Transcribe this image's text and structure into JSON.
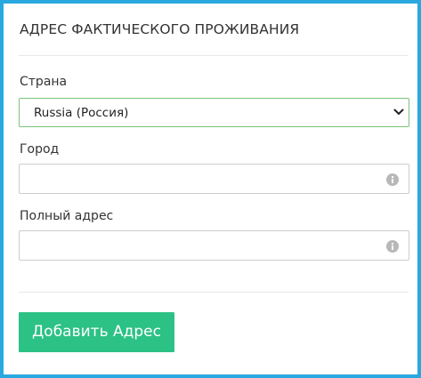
{
  "section": {
    "title": "АДРЕС ФАКТИЧЕСКОГО ПРОЖИВАНИЯ"
  },
  "country": {
    "label": "Страна",
    "selected": "Russia (Россия)"
  },
  "city": {
    "label": "Город",
    "value": ""
  },
  "address": {
    "label": "Полный адрес",
    "value": ""
  },
  "actions": {
    "add_label": "Добавить Адрес"
  },
  "colors": {
    "border": "#29a8e0",
    "button": "#2cc185",
    "select_border": "#7ac47a"
  },
  "icons": {
    "select_arrow": "chevron-down-icon",
    "field_hint": "info-icon"
  }
}
